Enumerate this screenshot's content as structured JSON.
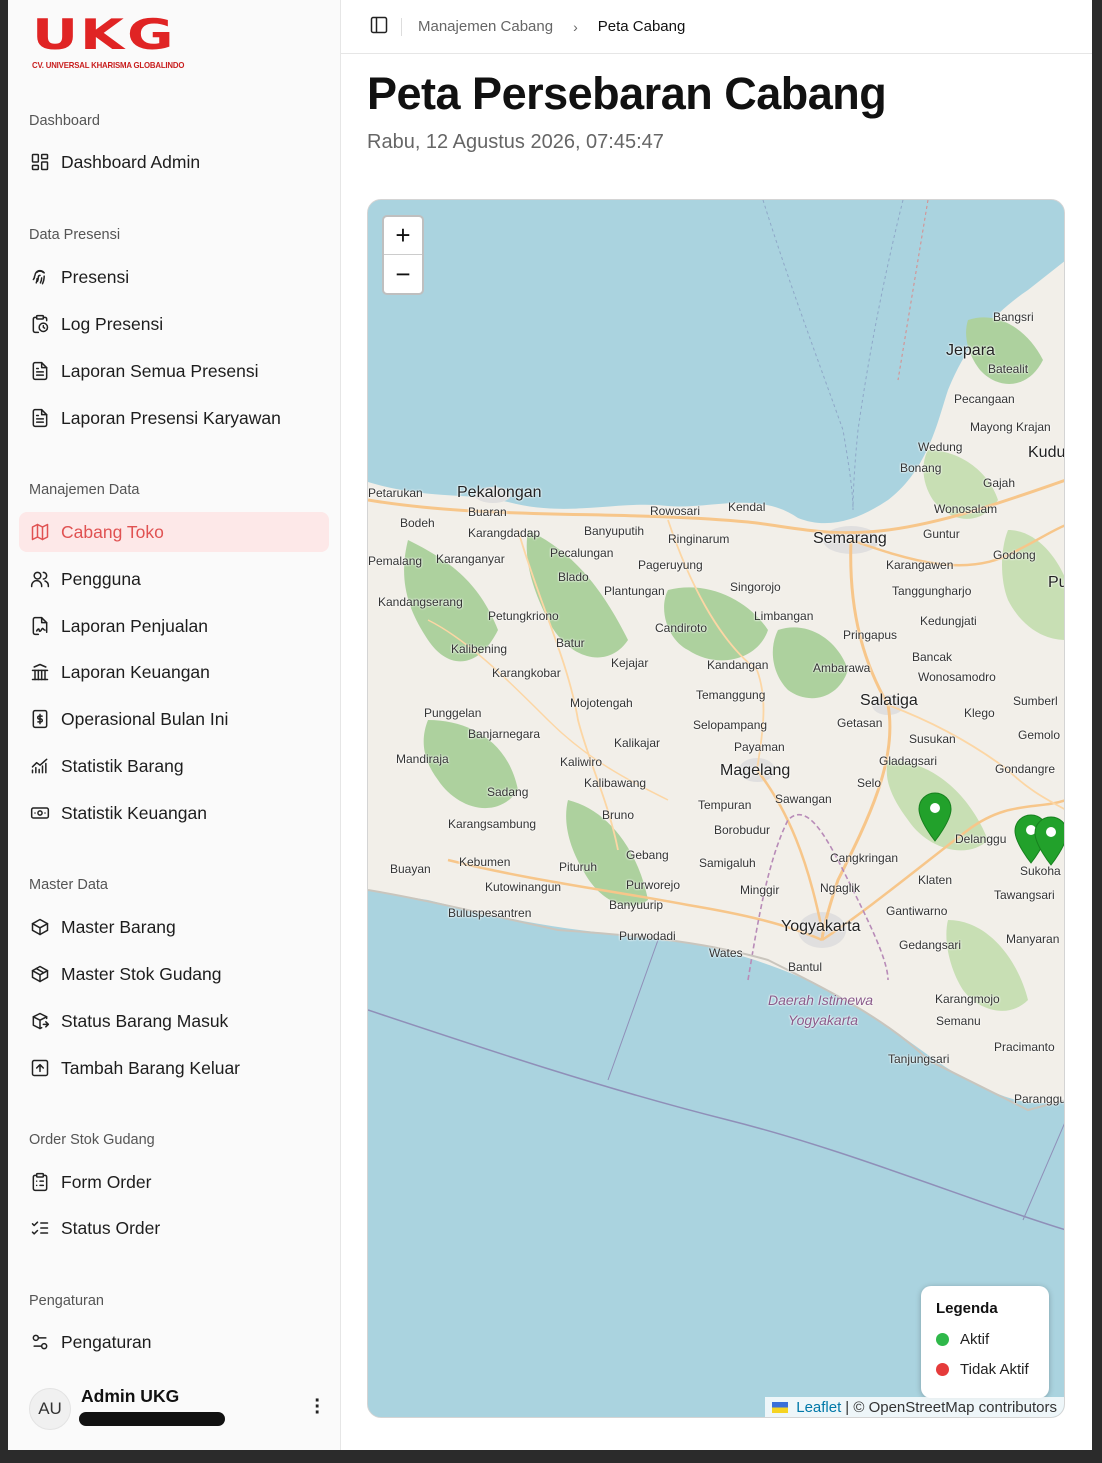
{
  "logo": {
    "mark": [
      "U",
      "K",
      "G"
    ],
    "subtitle": "CV. UNIVERSAL KHARISMA GLOBALINDO",
    "color": "#e02424"
  },
  "sidebar": {
    "sections": [
      {
        "heading": "Dashboard",
        "items": [
          {
            "label": "Dashboard Admin",
            "icon": "dashboard-grid-icon"
          }
        ]
      },
      {
        "heading": "Data Presensi",
        "items": [
          {
            "label": "Presensi",
            "icon": "fingerprint-icon"
          },
          {
            "label": "Log Presensi",
            "icon": "clipboard-clock-icon"
          },
          {
            "label": "Laporan Semua Presensi",
            "icon": "file-text-icon"
          },
          {
            "label": "Laporan Presensi Karyawan",
            "icon": "file-text-icon"
          }
        ]
      },
      {
        "heading": "Manajemen Data",
        "items": [
          {
            "label": "Cabang Toko",
            "icon": "map-icon",
            "active": true
          },
          {
            "label": "Pengguna",
            "icon": "users-icon"
          },
          {
            "label": "Laporan Penjualan",
            "icon": "file-signature-icon"
          },
          {
            "label": "Laporan Keuangan",
            "icon": "bank-icon"
          },
          {
            "label": "Operasional Bulan Ini",
            "icon": "dollar-file-icon"
          },
          {
            "label": "Statistik Barang",
            "icon": "chart-line-icon"
          },
          {
            "label": "Statistik Keuangan",
            "icon": "banknote-icon"
          }
        ]
      },
      {
        "heading": "Master Data",
        "items": [
          {
            "label": "Master Barang",
            "icon": "package-icon"
          },
          {
            "label": "Master Stok Gudang",
            "icon": "package-open-icon"
          },
          {
            "label": "Status Barang Masuk",
            "icon": "box-arrow-icon"
          },
          {
            "label": "Tambah Barang Keluar",
            "icon": "square-arrow-up-icon"
          }
        ]
      },
      {
        "heading": "Order Stok Gudang",
        "items": [
          {
            "label": "Form Order",
            "icon": "clipboard-list-icon"
          },
          {
            "label": "Status Order",
            "icon": "list-checks-icon"
          }
        ]
      },
      {
        "heading": "Pengaturan",
        "items": [
          {
            "label": "Pengaturan",
            "icon": "settings-sliders-icon"
          }
        ]
      }
    ],
    "user": {
      "initials": "AU",
      "name": "Admin UKG"
    }
  },
  "header": {
    "breadcrumb": [
      "Manajemen Cabang",
      "Peta Cabang"
    ]
  },
  "page": {
    "title": "Peta Persebaran Cabang",
    "datetime": "Rabu, 12 Agustus 2026, 07:45:47"
  },
  "map": {
    "zoom_in": "+",
    "zoom_out": "−",
    "labels": [
      "Bangsri",
      "Jepara",
      "Batealit",
      "Pecangaan",
      "Mayong Krajan",
      "Kudu",
      "Wedung",
      "Bonang",
      "Gajah",
      "Petarukan",
      "Pekalongan",
      "Bodeh",
      "Buaran",
      "Karangdadap",
      "Banyuputih",
      "Rowosari",
      "Kendal",
      "Ringinarum",
      "Semarang",
      "Wonosalam",
      "Guntur",
      "Godong",
      "Pu",
      "Karangawen",
      "Tanggungharjo",
      "Pemalang",
      "Karanganyar",
      "Pecalungan",
      "Blado",
      "Pageruyung",
      "Plantungan",
      "Singorojo",
      "Kandangserang",
      "Petungkriono",
      "Limbangan",
      "Candiroto",
      "Pringapus",
      "Kedungjati",
      "Batur",
      "Kalibening",
      "Kejajar",
      "Kandangan",
      "Ambarawa",
      "Bancak",
      "Wonosamodro",
      "Karangkobar",
      "Mojotengah",
      "Temanggung",
      "Salatiga",
      "Klego",
      "Sumberl",
      "Punggelan",
      "Selopampang",
      "Getasan",
      "Gemolo",
      "Banjarnegara",
      "Kalikajar",
      "Payaman",
      "Susukan",
      "Mandiraja",
      "Kaliwiro",
      "Magelang",
      "Gladagsari",
      "Gondangre",
      "Kalibawang",
      "Selo",
      "Sadang",
      "Tempuran",
      "Sawangan",
      "Bruno",
      "Borobudur",
      "Karangsambung",
      "Delanggu",
      "Gebang",
      "Kebumen",
      "Pituruh",
      "Samigaluh",
      "Cangkringan",
      "Buayan",
      "Sukoha",
      "Kutowinangun",
      "Purworejo",
      "Minggir",
      "Ngaglik",
      "Klaten",
      "Tawangsari",
      "Banyuurip",
      "Buluspesantren",
      "Gantiwarno",
      "Purwodadi",
      "Yogyakarta",
      "Manyaran",
      "Wates",
      "Gedangsari",
      "Bantul",
      "Daerah Istimewa",
      "Yogyakarta",
      "Karangmojo",
      "Semanu",
      "Pracimanto",
      "Tanjungsari",
      "Paranggu"
    ],
    "markers": [
      {
        "status": "Aktif",
        "color": "#22a12b"
      },
      {
        "status": "Aktif",
        "color": "#22a12b"
      },
      {
        "status": "Aktif",
        "color": "#22a12b"
      }
    ],
    "legend": {
      "title": "Legenda",
      "items": [
        {
          "label": "Aktif",
          "color": "#2fb84a"
        },
        {
          "label": "Tidak Aktif",
          "color": "#e53b3b"
        }
      ]
    },
    "attribution": {
      "leaflet": "Leaflet",
      "rest": "| © OpenStreetMap contributors"
    }
  },
  "colors": {
    "accent": "#e05252",
    "active_bg": "#fde8e8",
    "sea": "#aad3df",
    "land": "#f2efe9"
  }
}
